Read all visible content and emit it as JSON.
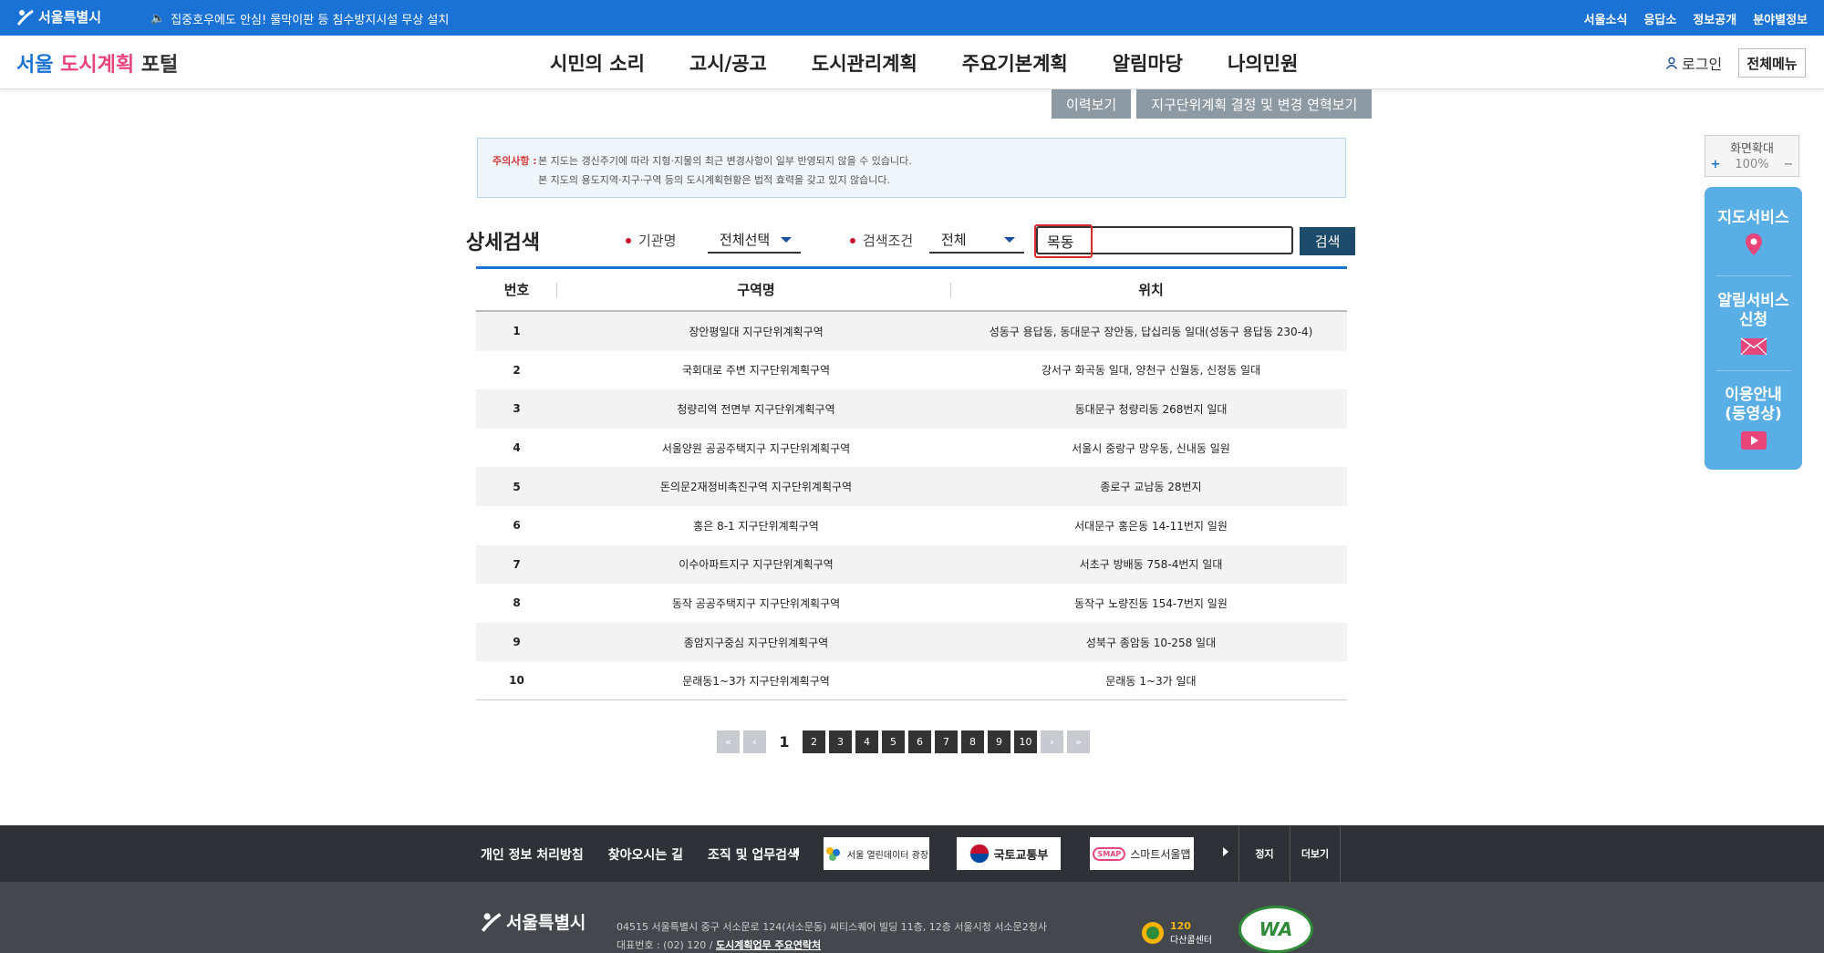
{
  "topbar": {
    "logo": "서울특별시",
    "notice": "집중호우에도 안심! 물막이판 등 침수방지시설 무상 설치",
    "links": [
      "서울소식",
      "응답소",
      "정보공개",
      "분야별정보"
    ]
  },
  "header": {
    "title_part1": "서울 ",
    "title_highlight": "도시계획",
    "title_part2": " 포털",
    "nav": [
      "시민의 소리",
      "고시/공고",
      "도시관리계획",
      "주요기본계획",
      "알림마당",
      "나의민원"
    ],
    "login": "로그인",
    "all_menu": "전체메뉴"
  },
  "tabs": [
    "이력보기",
    "지구단위계획 결정 및 변경 연혁보기"
  ],
  "notice_box": {
    "label": "주의사항 :",
    "line1": "본 지도는 갱신주기에 따라 지형·지물의 최근 변경사항이 일부 반영되지 않을 수 있습니다.",
    "line2": "본 지도의 용도지역·지구·구역 등의 도시계획현황은 법적 효력을 갖고 있지 않습니다."
  },
  "search": {
    "title": "상세검색",
    "org_label": "기관명",
    "org_value": "전체선택",
    "cond_label": "검색조건",
    "cond_value": "전체",
    "query": "목동",
    "button": "검색"
  },
  "table": {
    "headers": [
      "번호",
      "구역명",
      "위치"
    ],
    "rows": [
      {
        "no": "1",
        "name": "장안평일대 지구단위계획구역",
        "loc": "성동구 용답동, 동대문구 장안동, 답십리동 일대(성동구 용답동 230-4)"
      },
      {
        "no": "2",
        "name": "국회대로 주변 지구단위계획구역",
        "loc": "강서구 화곡동 일대, 양천구 신월동, 신정동 일대"
      },
      {
        "no": "3",
        "name": "청량리역 전면부 지구단위계획구역",
        "loc": "동대문구 청량리동 268번지 일대"
      },
      {
        "no": "4",
        "name": "서울양원 공공주택지구 지구단위계획구역",
        "loc": "서울시 중랑구 망우동, 신내동 일원"
      },
      {
        "no": "5",
        "name": "돈의문2재정비촉진구역 지구단위계획구역",
        "loc": "종로구 교남동 28번지"
      },
      {
        "no": "6",
        "name": "홍은 8-1 지구단위계획구역",
        "loc": "서대문구 홍은동 14-11번지 일원"
      },
      {
        "no": "7",
        "name": "이수아파트지구 지구단위계획구역",
        "loc": "서초구 방배동 758-4번지 일대"
      },
      {
        "no": "8",
        "name": "동작 공공주택지구 지구단위계획구역",
        "loc": "동작구 노량진동 154-7번지 일원"
      },
      {
        "no": "9",
        "name": "종암지구중심 지구단위계획구역",
        "loc": "성북구 종암동 10-258 일대"
      },
      {
        "no": "10",
        "name": "문래동1~3가 지구단위계획구역",
        "loc": "문래동 1~3가 일대"
      }
    ]
  },
  "pagination": {
    "first": "«",
    "prev": "‹",
    "next": "›",
    "last": "»",
    "current": "1",
    "pages": [
      "2",
      "3",
      "4",
      "5",
      "6",
      "7",
      "8",
      "9",
      "10"
    ]
  },
  "zoom": {
    "title": "화면확대",
    "plus": "+",
    "value": "100%",
    "minus": "−"
  },
  "quick_menu": {
    "map_service": "지도서비스",
    "alert_line1": "알림서비스",
    "alert_line2": "신청",
    "guide_line1": "이용안내",
    "guide_line2": "(동영상)"
  },
  "footer": {
    "links": [
      "개인 정보 처리방침",
      "찾아오시는 길",
      "조직 및 업무검색"
    ],
    "banners": [
      "서울 열린데이터 광장",
      "국토교통부",
      "스마트서울맵"
    ],
    "smap": "SMAP",
    "stop": "정지",
    "more": "더보기",
    "logo": "서울특별시",
    "address": "04515 서울특별시 중구 서소문로 124(서소문동) 씨티스퀘어 빌딩 11층, 12층 서울시청 서소문2청사",
    "tel_prefix": "대표번호 : (02) 120 / ",
    "tel_link": "도시계획업무 주요연락처",
    "c120_num": "120",
    "c120_label": "다산콜센터",
    "wa": "WA"
  },
  "colors": {
    "topbar": "#1a73d4",
    "accent": "#e8457a",
    "search_btn": "#1f4b6b",
    "quick": "#5aaee6"
  }
}
